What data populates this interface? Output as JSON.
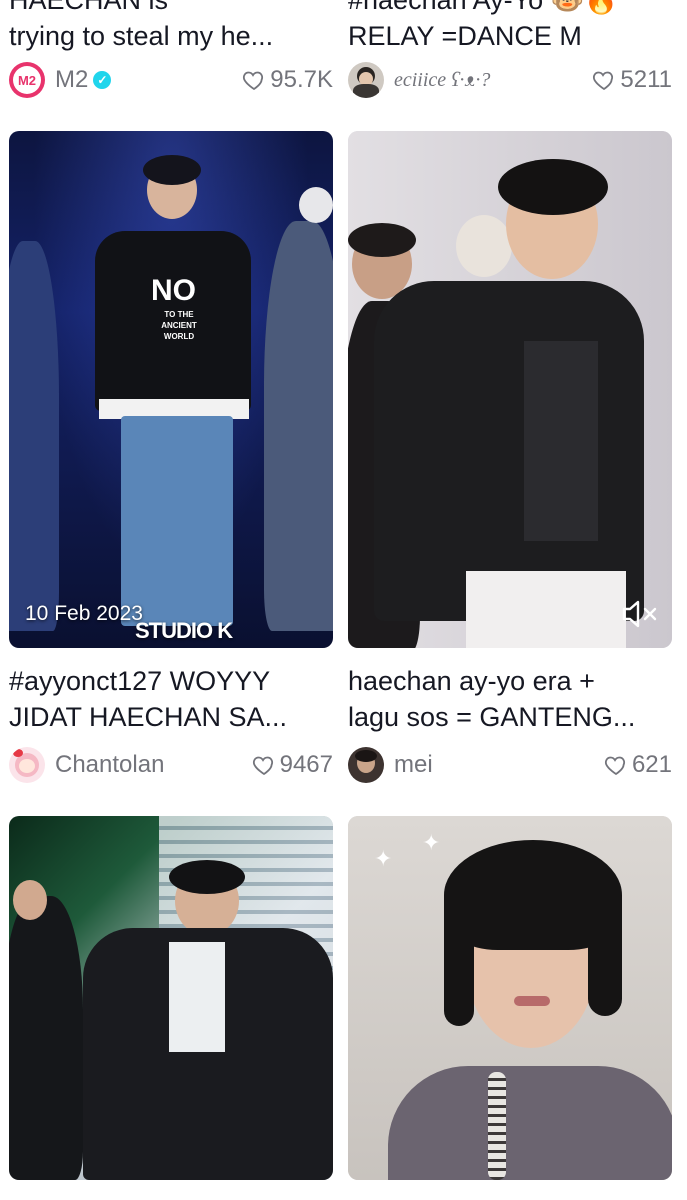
{
  "feed": {
    "row1": {
      "left": {
        "title_partial": "HAECHAN is",
        "title": "trying to steal my he...",
        "author": "M2",
        "verified": true,
        "likes": "95.7K"
      },
      "right": {
        "title_partial": "#haechan Ay-Yo 🐵🔥",
        "title": "RELAY =DANCE M",
        "author": "eciiice ʕ·ᴥ·?",
        "likes": "5211"
      }
    },
    "row2": {
      "left": {
        "overlay_date": "10 Feb 2023",
        "overlay_brand": "STUDIO K",
        "title_line1": "#ayyonct127 WOYYY",
        "title_line2": "JIDAT HAECHAN SA...",
        "author": "Chantolan",
        "likes": "9467"
      },
      "right": {
        "title_line1": "haechan ay-yo era +",
        "title_line2": "lagu sos = GANTENG...",
        "author": "mei",
        "likes": "621"
      }
    },
    "thumbnails": {
      "t1_shirt_text": "NO",
      "t1_shirt_sub": "TO THE ANCIENT WORLD"
    },
    "colors": {
      "verified": "#20d5ec",
      "secondary_text": "#73747b",
      "primary_text": "#161823",
      "m2_brand": "#e8336c"
    }
  }
}
